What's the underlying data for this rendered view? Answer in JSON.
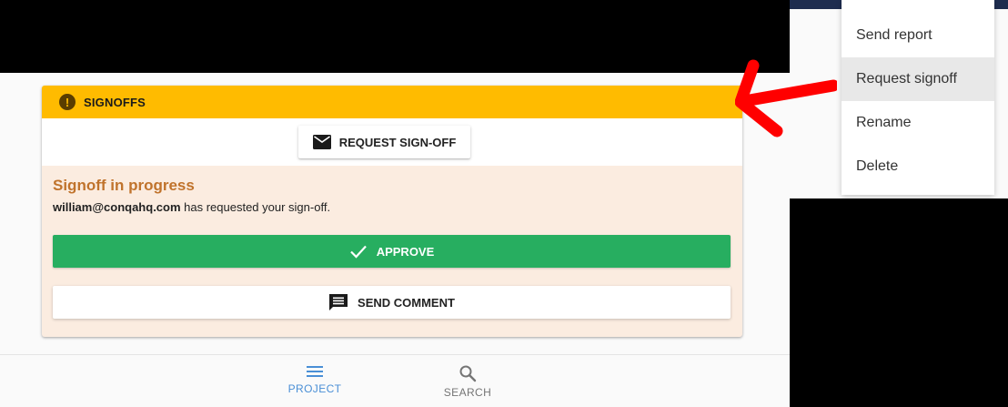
{
  "card": {
    "header_title": "SIGNOFFS",
    "warning_icon": "warning-icon",
    "request_button_label": "REQUEST SIGN-OFF",
    "status_title": "Signoff in progress",
    "requester_email": "william@conqahq.com",
    "status_message": " has requested your sign-off.",
    "approve_label": "APPROVE",
    "comment_label": "SEND COMMENT"
  },
  "menu": {
    "items": [
      {
        "label": "Send report"
      },
      {
        "label": "Request signoff",
        "active": true
      },
      {
        "label": "Rename"
      },
      {
        "label": "Delete"
      }
    ]
  },
  "bottom_nav": {
    "items": [
      {
        "label": "PROJECT",
        "icon": "hamburger-menu-icon",
        "active": true
      },
      {
        "label": "SEARCH",
        "icon": "search-icon"
      }
    ]
  },
  "colors": {
    "header": "#ffbb00",
    "approve": "#27ae60",
    "status_title": "#c0732c",
    "card_body": "#fbece0",
    "nav_active": "#4a8fd6",
    "annotation_arrow": "#ff0000"
  }
}
